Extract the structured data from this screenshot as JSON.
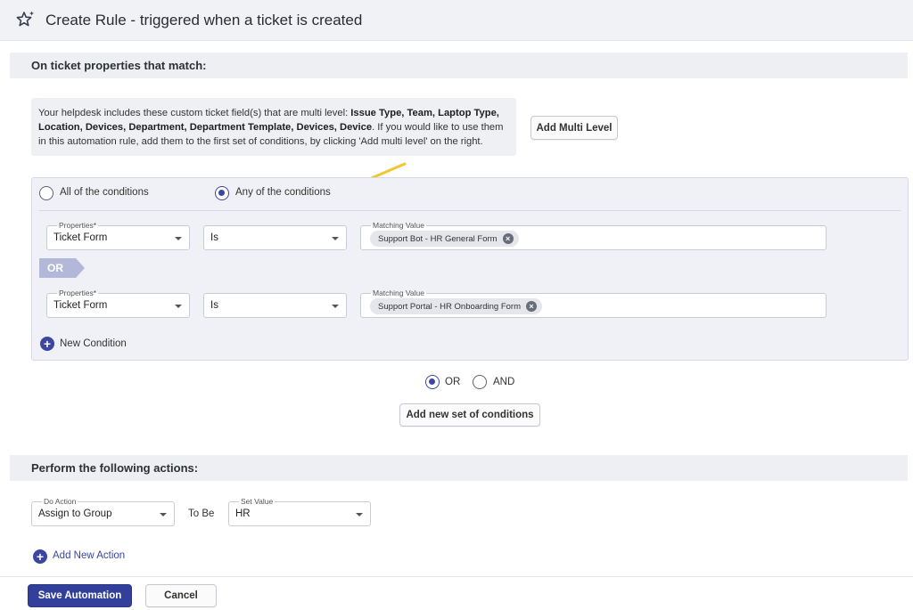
{
  "header": {
    "title": "Create Rule - triggered when a ticket is created"
  },
  "conditions_section": {
    "heading": "On ticket properties that match:",
    "info_text_1": "Your helpdesk includes these custom ticket field(s) that are multi level: ",
    "info_fields": "Issue Type, Team, Laptop Type, Location, Devices, Department, Department Template, Devices, Device",
    "info_text_2": ". If you would like to use them in this automation rule, add them to the first set of conditions, by clicking 'Add multi level' on the right.",
    "add_multi_level_label": "Add Multi Level",
    "match_all_label": "All of the conditions",
    "match_any_label": "Any of the conditions",
    "match_selected": "any",
    "conditions": [
      {
        "property_label": "Properties*",
        "property_value": "Ticket Form",
        "operator": "Is",
        "value_label": "Matching Value",
        "chip": "Support Bot - HR General Form"
      },
      {
        "property_label": "Properties*",
        "property_value": "Ticket Form",
        "operator": "Is",
        "value_label": "Matching Value",
        "chip": "Support Portal - HR Onboarding Form"
      }
    ],
    "or_tag": "OR",
    "new_condition_label": "New Condition",
    "set_join_or": "OR",
    "set_join_and": "AND",
    "set_join_selected": "OR",
    "add_set_label": "Add new set of conditions"
  },
  "actions_section": {
    "heading": "Perform the following actions:",
    "do_action_label": "Do Action",
    "do_action_value": "Assign to Group",
    "to_be_label": "To Be",
    "set_value_label": "Set Value",
    "set_value_value": "HR",
    "add_action_label": "Add New Action"
  },
  "footer": {
    "save_label": "Save Automation",
    "cancel_label": "Cancel"
  },
  "colors": {
    "primary": "#33409b",
    "annotation_arrow": "#f2c630",
    "or_tag": "#b4b8d8"
  },
  "icons": {
    "title": "sparkle-star-icon"
  }
}
